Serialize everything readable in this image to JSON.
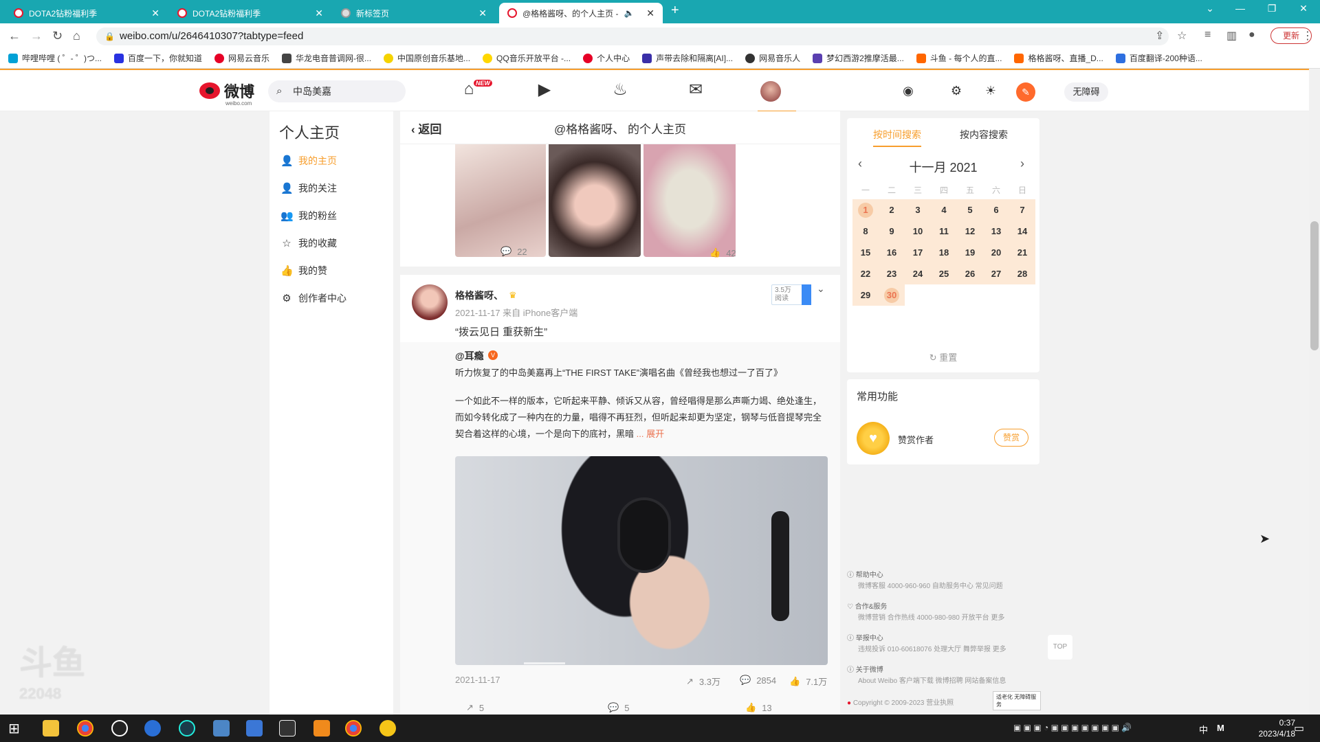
{
  "browser": {
    "tabs": [
      {
        "label": "DOTA2钻粉福利季"
      },
      {
        "label": "DOTA2钻粉福利季"
      },
      {
        "label": "新标签页"
      },
      {
        "label": "@格格酱呀、的个人主页 -"
      }
    ],
    "new_tab": "+",
    "url": "weibo.com/u/2646410307?tabtype=feed",
    "update_label": "更新",
    "bookmarks": [
      "哔哩哔哩 ( ゜- ゜)つ...",
      "百度一下，你就知道",
      "网易云音乐",
      "华龙电音普调网-很...",
      "中国原创音乐基地...",
      "QQ音乐开放平台 -...",
      "个人中心",
      "声带去除和隔离[AI]...",
      "网易音乐人",
      "梦幻西游2推摩活最...",
      "斗鱼 - 每个人的直...",
      "格格酱呀、直播_D...",
      "百度翻译-200种语..."
    ]
  },
  "header": {
    "logo": "微博",
    "logo_sub": "weibo.com",
    "search_value": "中岛美嘉",
    "new_badge": "NEW",
    "a11y_label": "无障碍"
  },
  "sidebar": {
    "title": "个人主页",
    "items": [
      {
        "label": "我的主页",
        "icon": "user-icon"
      },
      {
        "label": "我的关注",
        "icon": "follow-icon"
      },
      {
        "label": "我的粉丝",
        "icon": "fans-icon"
      },
      {
        "label": "我的收藏",
        "icon": "star-icon"
      },
      {
        "label": "我的赞",
        "icon": "thumb-icon"
      },
      {
        "label": "创作者中心",
        "icon": "gear-icon"
      }
    ]
  },
  "feed": {
    "back_label": "返回",
    "title": "@格格酱呀、 的个人主页",
    "prev_post": {
      "comments": "22",
      "likes": "42"
    },
    "post": {
      "author": "格格酱呀、",
      "time": "2021-11-17  来自 iPhone客户端",
      "hot_value": "3.5万",
      "hot_label": "阅读",
      "text": "“拨云见日 重获新生”",
      "repost": {
        "author": "@耳瘾",
        "line1": "听力恢复了的中岛美嘉再上“THE FIRST TAKE”演唱名曲《曾经我也想过一了百了》",
        "body": "一个如此不一样的版本，它听起来平静、倾诉又从容，曾经唱得是那么声嘶力竭、绝处逢生，而如今转化成了一种内在的力量，唱得不再狂烈，但听起来却更为坚定，钢琴与低音提琴完全契合着这样的心境，一个是向下的底衬，黑暗",
        "expand": "... 展开",
        "date": "2021-11-17",
        "shares": "3.3万",
        "comments": "2854",
        "likes": "7.1万"
      },
      "shares": "5",
      "comments": "5",
      "likes": "13"
    }
  },
  "calendar": {
    "tab_time": "按时间搜索",
    "tab_content": "按内容搜索",
    "month": "十一月 2021",
    "weekdays": [
      "一",
      "二",
      "三",
      "四",
      "五",
      "六",
      "日"
    ],
    "days": [
      "1",
      "2",
      "3",
      "4",
      "5",
      "6",
      "7",
      "8",
      "9",
      "10",
      "11",
      "12",
      "13",
      "14",
      "15",
      "16",
      "17",
      "18",
      "19",
      "20",
      "21",
      "22",
      "23",
      "24",
      "25",
      "26",
      "27",
      "28",
      "29",
      "30"
    ],
    "reset": "重置"
  },
  "common": {
    "title": "常用功能",
    "reward_label": "赞赏作者",
    "reward_btn": "赞赏"
  },
  "footer": {
    "help": "帮助中心",
    "help_links": "微博客服 4000-960-960    自助服务中心    常见问题",
    "coop": "合作&服务",
    "coop_links": "微博营销    合作热线 4000-980-980    开放平台    更多",
    "report": "举报中心",
    "report_links": "违规投诉 010-60618076    处理大厅    舞弊举报    更多",
    "about": "关于微博",
    "about_links": "About Weibo    客户端下载    微博招聘    网站备案信息",
    "copyright": "Copyright © 2009-2023 营业执照",
    "badge": "适老化 无障碍服务",
    "top": "TOP"
  },
  "taskbar": {
    "time": "0:37",
    "date": "2023/4/18",
    "ime": "中",
    "ime2": "M"
  },
  "watermark": {
    "line1": "斗鱼",
    "line2": "22048"
  }
}
